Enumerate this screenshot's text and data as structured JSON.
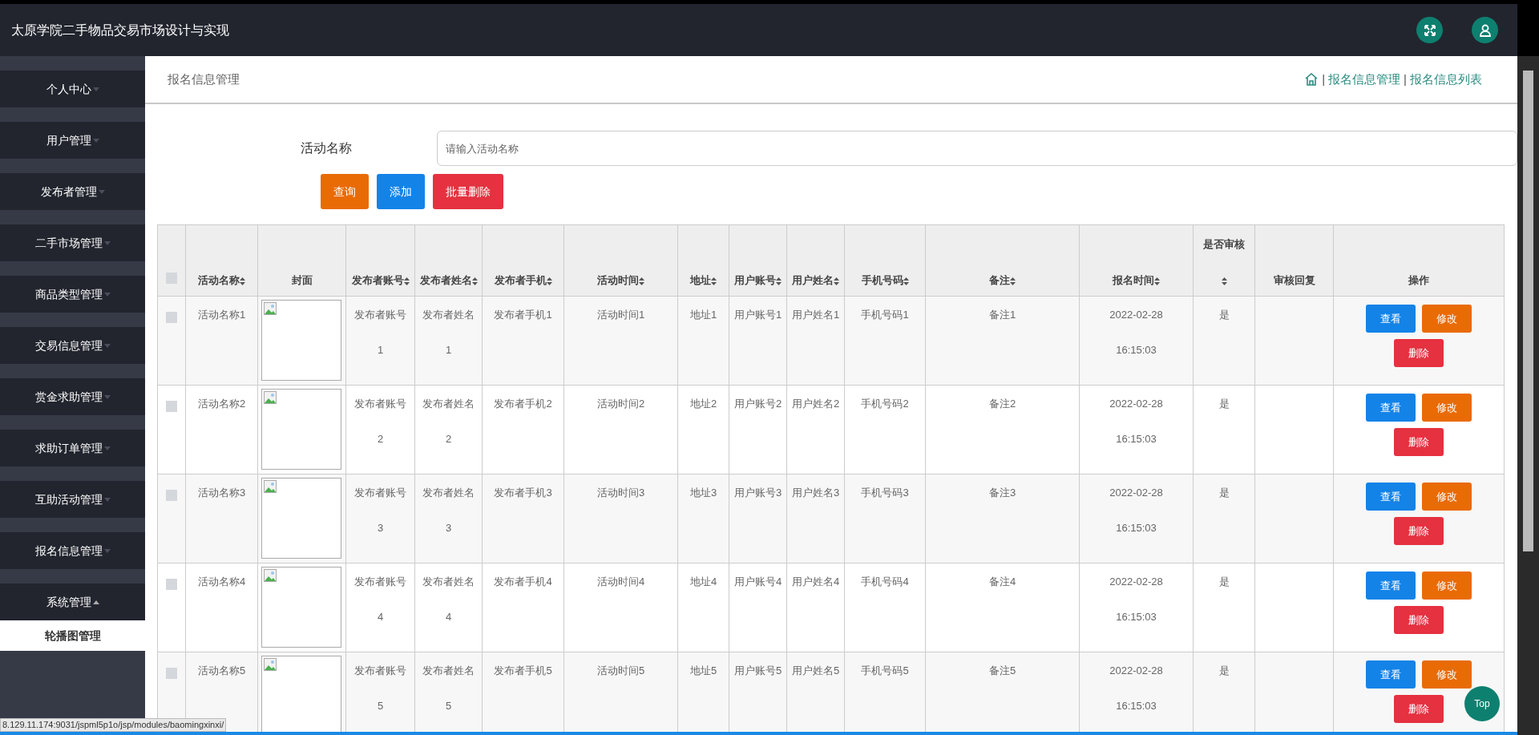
{
  "app_title": "太原学院二手物品交易市场设计与实现",
  "sidebar": {
    "items": [
      {
        "label": "个人中心",
        "expanded": false
      },
      {
        "label": "用户管理",
        "expanded": false
      },
      {
        "label": "发布者管理",
        "expanded": false
      },
      {
        "label": "二手市场管理",
        "expanded": false
      },
      {
        "label": "商品类型管理",
        "expanded": false
      },
      {
        "label": "交易信息管理",
        "expanded": false
      },
      {
        "label": "赏金求助管理",
        "expanded": false
      },
      {
        "label": "求助订单管理",
        "expanded": false
      },
      {
        "label": "互助活动管理",
        "expanded": false
      },
      {
        "label": "报名信息管理",
        "expanded": false
      },
      {
        "label": "系统管理",
        "expanded": true,
        "children": [
          {
            "label": "轮播图管理"
          }
        ]
      }
    ]
  },
  "page_title": "报名信息管理",
  "breadcrumb": {
    "separator": "|",
    "items": [
      "报名信息管理",
      "报名信息列表"
    ]
  },
  "search": {
    "label": "活动名称",
    "placeholder": "请输入活动名称"
  },
  "buttons": [
    {
      "label": "查询",
      "kind": "search"
    },
    {
      "label": "添加",
      "kind": "add"
    },
    {
      "label": "批量删除",
      "kind": "batch_delete"
    }
  ],
  "table": {
    "columns": [
      {
        "kind": "checkbox",
        "checked": false
      },
      {
        "label": "活动名称",
        "sortable": true
      },
      {
        "label": "封面",
        "sortable": false
      },
      {
        "label": "发布者账号",
        "sortable": true
      },
      {
        "label": "发布者姓名",
        "sortable": true
      },
      {
        "label": "发布者手机",
        "sortable": true
      },
      {
        "label": "活动时间",
        "sortable": true
      },
      {
        "label": "地址",
        "sortable": true
      },
      {
        "label": "用户账号",
        "sortable": true
      },
      {
        "label": "用户姓名",
        "sortable": true
      },
      {
        "label": "手机号码",
        "sortable": true
      },
      {
        "label": "备注",
        "sortable": true
      },
      {
        "label": "报名时间",
        "sortable": true
      },
      {
        "label": "是否审核",
        "sortable": true
      },
      {
        "label": "审核回复",
        "sortable": false
      },
      {
        "label": "操作",
        "sortable": false
      }
    ],
    "rows": [
      {
        "checked": false,
        "cells": [
          "",
          "活动名称1",
          "",
          "发布者账号1",
          "发布者姓名1",
          "发布者手机1",
          "活动时间1",
          "地址1",
          "用户账号1",
          "用户姓名1",
          "手机号码1",
          "备注1",
          "2022-02-28 16:15:03",
          "是",
          ""
        ],
        "actions": [
          {
            "label": "查看",
            "kind": "view"
          },
          {
            "label": "修改",
            "kind": "edit"
          },
          {
            "label": "删除",
            "kind": "delete"
          }
        ]
      },
      {
        "checked": false,
        "cells": [
          "",
          "活动名称2",
          "",
          "发布者账号2",
          "发布者姓名2",
          "发布者手机2",
          "活动时间2",
          "地址2",
          "用户账号2",
          "用户姓名2",
          "手机号码2",
          "备注2",
          "2022-02-28 16:15:03",
          "是",
          ""
        ],
        "actions": [
          {
            "label": "查看",
            "kind": "view"
          },
          {
            "label": "修改",
            "kind": "edit"
          },
          {
            "label": "删除",
            "kind": "delete"
          }
        ]
      },
      {
        "checked": false,
        "cells": [
          "",
          "活动名称3",
          "",
          "发布者账号3",
          "发布者姓名3",
          "发布者手机3",
          "活动时间3",
          "地址3",
          "用户账号3",
          "用户姓名3",
          "手机号码3",
          "备注3",
          "2022-02-28 16:15:03",
          "是",
          ""
        ],
        "actions": [
          {
            "label": "查看",
            "kind": "view"
          },
          {
            "label": "修改",
            "kind": "edit"
          },
          {
            "label": "删除",
            "kind": "delete"
          }
        ]
      },
      {
        "checked": false,
        "cells": [
          "",
          "活动名称4",
          "",
          "发布者账号4",
          "发布者姓名4",
          "发布者手机4",
          "活动时间4",
          "地址4",
          "用户账号4",
          "用户姓名4",
          "手机号码4",
          "备注4",
          "2022-02-28 16:15:03",
          "是",
          ""
        ],
        "actions": [
          {
            "label": "查看",
            "kind": "view"
          },
          {
            "label": "修改",
            "kind": "edit"
          },
          {
            "label": "删除",
            "kind": "delete"
          }
        ]
      },
      {
        "checked": false,
        "cells": [
          "",
          "活动名称5",
          "",
          "发布者账号5",
          "发布者姓名5",
          "发布者手机5",
          "活动时间5",
          "地址5",
          "用户账号5",
          "用户姓名5",
          "手机号码5",
          "备注5",
          "2022-02-28 16:15:03",
          "是",
          ""
        ],
        "actions": [
          {
            "label": "查看",
            "kind": "view"
          },
          {
            "label": "修改",
            "kind": "edit"
          },
          {
            "label": "删除",
            "kind": "delete"
          }
        ]
      }
    ]
  },
  "top_button": "Top",
  "status_bar": "8.129.11.174:9031/jspml5p1o/jsp/modules/baomingxinxi/"
}
